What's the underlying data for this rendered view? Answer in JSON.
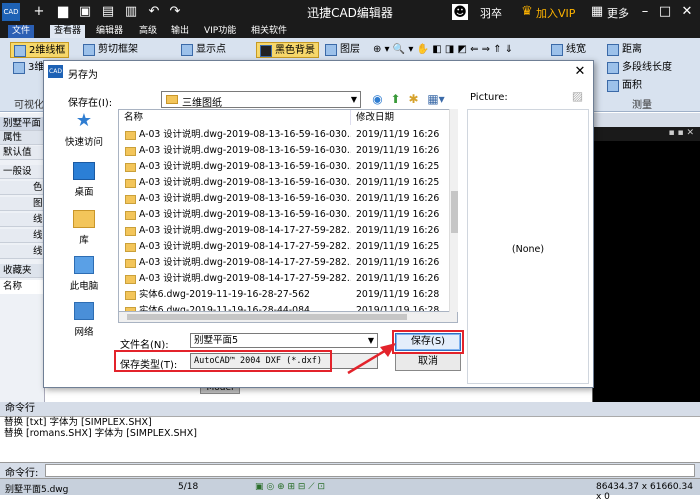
{
  "app": {
    "title": "迅捷CAD编辑器",
    "user": "羽卒",
    "vip_label": "加入VIP",
    "more_label": "更多"
  },
  "menu": [
    "文件",
    "查看器",
    "编辑器",
    "高级",
    "输出",
    "VIP功能",
    "相关软件"
  ],
  "ribbon": {
    "buttons": [
      "2维线框",
      "剪切框架",
      "显示点",
      "黑色背景",
      "图层",
      "线宽",
      "距离",
      "多段线长度",
      "面积"
    ],
    "partial_button": "3维",
    "group_labels": [
      "可视化",
      "测量"
    ]
  },
  "side_panel": {
    "tab": "别墅平面",
    "properties": "属性",
    "default": "默认值",
    "general": "一般设",
    "rows": [
      "色",
      "图",
      "线",
      "线",
      "线"
    ],
    "favorites": "收藏夹",
    "name": "名称"
  },
  "dialog": {
    "title": "另存为",
    "save_in_label": "保存在(I):",
    "save_in_value": "三维图纸",
    "preview_label": "Picture:",
    "preview_none": "(None)",
    "columns": {
      "name": "名称",
      "date": "修改日期"
    },
    "files": [
      {
        "name": "A-03 设计说明.dwg-2019-08-13-16-59-16-030...",
        "date": "2019/11/19 16:26"
      },
      {
        "name": "A-03 设计说明.dwg-2019-08-13-16-59-16-030...",
        "date": "2019/11/19 16:26"
      },
      {
        "name": "A-03 设计说明.dwg-2019-08-13-16-59-16-030...",
        "date": "2019/11/19 16:25"
      },
      {
        "name": "A-03 设计说明.dwg-2019-08-13-16-59-16-030...",
        "date": "2019/11/19 16:25"
      },
      {
        "name": "A-03 设计说明.dwg-2019-08-13-16-59-16-030...",
        "date": "2019/11/19 16:26"
      },
      {
        "name": "A-03 设计说明.dwg-2019-08-13-16-59-16-030...",
        "date": "2019/11/19 16:26"
      },
      {
        "name": "A-03 设计说明.dwg-2019-08-14-17-27-59-282...",
        "date": "2019/11/19 16:26"
      },
      {
        "name": "A-03 设计说明.dwg-2019-08-14-17-27-59-282...",
        "date": "2019/11/19 16:25"
      },
      {
        "name": "A-03 设计说明.dwg-2019-08-14-17-27-59-282...",
        "date": "2019/11/19 16:26"
      },
      {
        "name": "A-03 设计说明.dwg-2019-08-14-17-27-59-282...",
        "date": "2019/11/19 16:26"
      },
      {
        "name": "实体6.dwg-2019-11-19-16-28-27-562",
        "date": "2019/11/19 16:28"
      },
      {
        "name": "实体6.dwg-2019-11-19-16-28-44-084",
        "date": "2019/11/19 16:28"
      }
    ],
    "places": [
      "快速访问",
      "桌面",
      "库",
      "此电脑",
      "网络"
    ],
    "filename_label": "文件名(N):",
    "filename_value": "别墅平面5",
    "filetype_label": "保存类型(T):",
    "filetype_value": "AutoCAD™ 2004 DXF (*.dxf)",
    "save_button": "保存(S)",
    "cancel_button": "取消"
  },
  "canvas": {
    "model_tab": "Model"
  },
  "command": {
    "label": "命令行",
    "log": [
      "替换 [txt] 字体为 [SIMPLEX.SHX]",
      "替换 [romans.SHX] 字体为 [SIMPLEX.SHX]"
    ],
    "input_label": "命令行:"
  },
  "status": {
    "file": "别墅平面5.dwg",
    "page": "5/18",
    "coords": "86434.37 x 61660.34 x 0"
  },
  "colors": {
    "accent": "#f7d86b",
    "annotation": "#e3232b",
    "title_bar": "#1b1b1b"
  }
}
